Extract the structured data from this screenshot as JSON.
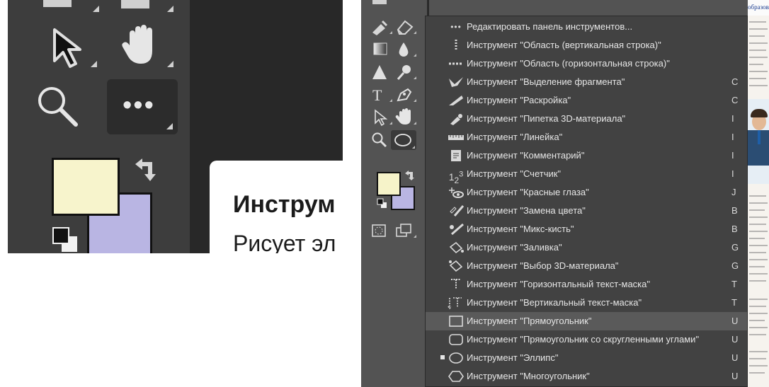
{
  "zoom_panel": {
    "tooltip_title": "Инструм",
    "tooltip_desc": "Рисует эл"
  },
  "colors": {
    "foreground": "#f6f3c9",
    "background": "#b9b5e3",
    "highlight": "#5a5a5a",
    "menu_bg": "#424242"
  },
  "menu": {
    "items": [
      {
        "icon": "dots-icon",
        "label": "Редактировать панель инструментов...",
        "key": "",
        "highlighted": false,
        "active": false
      },
      {
        "icon": "single-column-marquee-icon",
        "label": "Инструмент \"Область (вертикальная строка)\"",
        "key": "",
        "highlighted": false,
        "active": false
      },
      {
        "icon": "single-row-marquee-icon",
        "label": "Инструмент \"Область (горизонтальная строка)\"",
        "key": "",
        "highlighted": false,
        "active": false
      },
      {
        "icon": "slice-select-icon",
        "label": "Инструмент \"Выделение фрагмента\"",
        "key": "C",
        "highlighted": false,
        "active": false
      },
      {
        "icon": "slice-icon",
        "label": "Инструмент \"Раскройка\"",
        "key": "C",
        "highlighted": false,
        "active": false
      },
      {
        "icon": "3d-material-eyedropper-icon",
        "label": "Инструмент \"Пипетка 3D-материала\"",
        "key": "I",
        "highlighted": false,
        "active": false
      },
      {
        "icon": "ruler-icon",
        "label": "Инструмент \"Линейка\"",
        "key": "I",
        "highlighted": false,
        "active": false
      },
      {
        "icon": "note-icon",
        "label": "Инструмент \"Комментарий\"",
        "key": "I",
        "highlighted": false,
        "active": false
      },
      {
        "icon": "count-icon",
        "label": "Инструмент \"Счетчик\"",
        "key": "I",
        "highlighted": false,
        "active": false
      },
      {
        "icon": "red-eye-icon",
        "label": "Инструмент \"Красные глаза\"",
        "key": "J",
        "highlighted": false,
        "active": false
      },
      {
        "icon": "color-replacement-icon",
        "label": "Инструмент \"Замена цвета\"",
        "key": "B",
        "highlighted": false,
        "active": false
      },
      {
        "icon": "mixer-brush-icon",
        "label": "Инструмент \"Микс-кисть\"",
        "key": "B",
        "highlighted": false,
        "active": false
      },
      {
        "icon": "paint-bucket-icon",
        "label": "Инструмент \"Заливка\"",
        "key": "G",
        "highlighted": false,
        "active": false
      },
      {
        "icon": "3d-material-drop-icon",
        "label": "Инструмент \"Выбор 3D-материала\"",
        "key": "G",
        "highlighted": false,
        "active": false
      },
      {
        "icon": "horizontal-type-mask-icon",
        "label": "Инструмент \"Горизонтальный текст-маска\"",
        "key": "T",
        "highlighted": false,
        "active": false
      },
      {
        "icon": "vertical-type-mask-icon",
        "label": "Инструмент \"Вертикальный текст-маска\"",
        "key": "T",
        "highlighted": false,
        "active": false
      },
      {
        "icon": "rectangle-icon",
        "label": "Инструмент \"Прямоугольник\"",
        "key": "U",
        "highlighted": true,
        "active": false
      },
      {
        "icon": "rounded-rectangle-icon",
        "label": "Инструмент \"Прямоугольник со скругленными углами\"",
        "key": "U",
        "highlighted": false,
        "active": false
      },
      {
        "icon": "ellipse-icon",
        "label": "Инструмент \"Эллипс\"",
        "key": "U",
        "highlighted": false,
        "active": true
      },
      {
        "icon": "polygon-icon",
        "label": "Инструмент \"Многоугольник\"",
        "key": "U",
        "highlighted": false,
        "active": false
      }
    ]
  },
  "document": {
    "header_text": "образования по специальност"
  }
}
